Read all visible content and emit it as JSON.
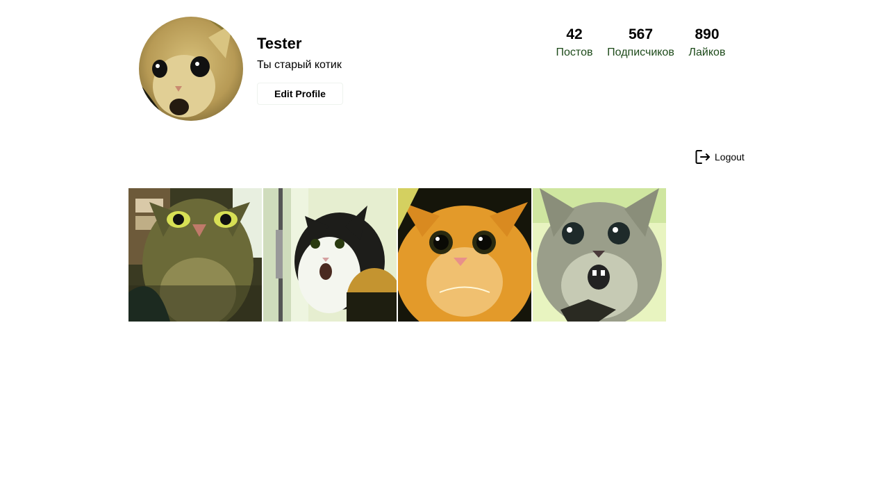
{
  "profile": {
    "username": "Tester",
    "bio": "Ты старый котик",
    "edit_button_label": "Edit Profile",
    "avatar": "cat-avatar-photo"
  },
  "stats": {
    "posts": {
      "value": "42",
      "label": "Постов"
    },
    "followers": {
      "value": "567",
      "label": "Подписчиков"
    },
    "likes": {
      "value": "890",
      "label": "Лайков"
    }
  },
  "logout": {
    "label": "Logout",
    "icon": "logout-icon"
  },
  "posts": [
    {
      "image": "startled-tabby-cat-photo"
    },
    {
      "image": "shocked-calico-cat-photo"
    },
    {
      "image": "wide-eyed-orange-cat-photo"
    },
    {
      "image": "screaming-grey-tabby-cat-photo"
    }
  ],
  "colors": {
    "stat_label": "#1d4a1a",
    "text": "#000000",
    "background": "#ffffff"
  }
}
